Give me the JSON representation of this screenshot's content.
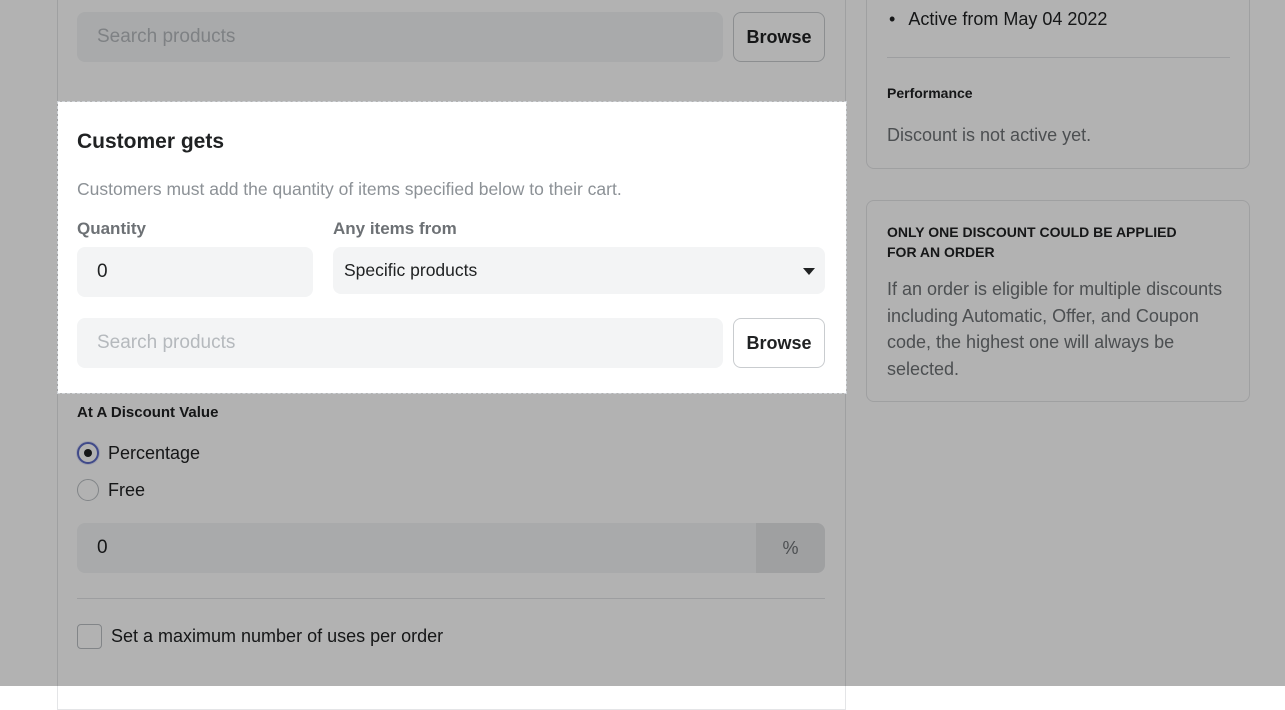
{
  "top": {
    "search_placeholder": "Search products",
    "browse_label": "Browse"
  },
  "sidebar": {
    "active_from": "Active from May 04 2022",
    "performance_title": "Performance",
    "performance_text": "Discount is not active yet.",
    "notice_title_line1": "ONLY ONE DISCOUNT COULD BE APPLIED",
    "notice_title_line2": "FOR AN ORDER",
    "notice_lines": [
      "If an order is eligible for multiple discounts",
      "including Automatic, Offer, and Coupon",
      "code, the highest one will always be",
      "selected."
    ]
  },
  "customer_gets": {
    "title": "Customer gets",
    "description": "Customers must add the quantity of items specified below to their cart.",
    "quantity_label": "Quantity",
    "quantity_value": "0",
    "any_items_label": "Any items from",
    "any_items_value": "Specific products",
    "search_placeholder": "Search products",
    "browse_label": "Browse"
  },
  "discount": {
    "title": "At A Discount Value",
    "option_percentage": "Percentage",
    "option_free": "Free",
    "selected": "Percentage",
    "value": "0",
    "suffix": "%",
    "max_uses_label": "Set a maximum number of uses per order",
    "max_uses_checked": false
  }
}
